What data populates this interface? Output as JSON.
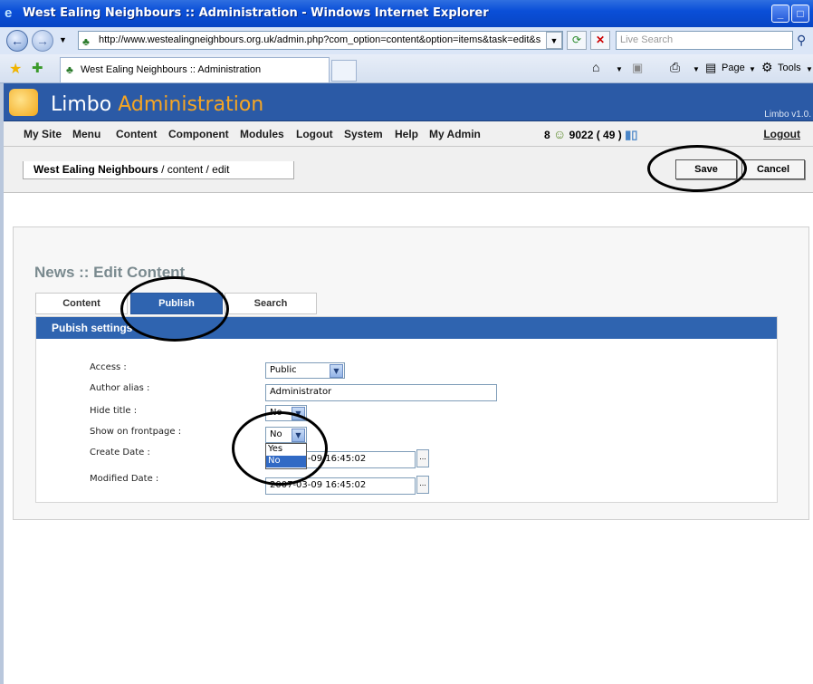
{
  "window": {
    "title": "West Ealing Neighbours :: Administration - Windows Internet Explorer"
  },
  "address_bar": {
    "url": "http://www.westealingneighbours.org.uk/admin.php?com_option=content&option=items&task=edit&s",
    "search_placeholder": "Live Search"
  },
  "browser_tab": {
    "title": "West Ealing Neighbours :: Administration"
  },
  "command_bar": {
    "page_label": "Page",
    "tools_label": "Tools"
  },
  "app": {
    "title_main": "Limbo",
    "title_accent": "Administration",
    "version": "Limbo v1.0."
  },
  "menu": {
    "items": [
      "My Site",
      "Menu",
      "Content",
      "Component",
      "Modules",
      "Logout",
      "System",
      "Help",
      "My Admin"
    ],
    "stats_left": "8",
    "stats_right": "9022 ( 49 )",
    "logout": "Logout"
  },
  "breadcrumb": {
    "site": "West Ealing Neighbours",
    "path": " / content / edit"
  },
  "toolbar": {
    "save_label": "Save",
    "cancel_label": "Cancel"
  },
  "page": {
    "title": "News :: Edit Content"
  },
  "tabs": [
    {
      "label": "Content",
      "active": false
    },
    {
      "label": "Publish",
      "active": true
    },
    {
      "label": "Search",
      "active": false
    }
  ],
  "publish_settings": {
    "header": "Pubish settings",
    "access_label": "Access :",
    "access_value": "Public",
    "author_alias_label": "Author alias :",
    "author_alias_value": "Administrator",
    "hide_title_label": "Hide title :",
    "hide_title_value": "No",
    "frontpage_label": "Show on frontpage :",
    "frontpage_value": "No",
    "frontpage_options": [
      "Yes",
      "No"
    ],
    "create_date_label": "Create Date :",
    "create_date_value": "2007-03-09 16:45:02",
    "modified_date_label": "Modified Date :",
    "modified_date_value": "2007-03-09 16:45:02",
    "date_button_label": "..."
  },
  "colors": {
    "accent_blue": "#2f64b0",
    "header_blue": "#2b5aa6",
    "brand_orange": "#f6a623"
  }
}
